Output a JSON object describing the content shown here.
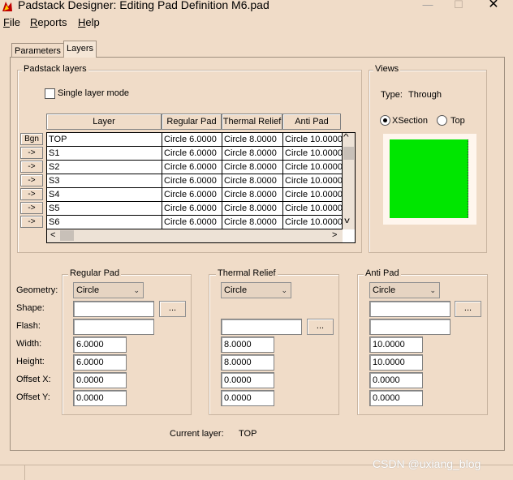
{
  "window": {
    "title": "Padstack Designer: Editing Pad Definition M6.pad",
    "app_icon": "app-logo-icon",
    "min_glyph": "—",
    "max_glyph": "☐",
    "close_glyph": "✕"
  },
  "menu": [
    {
      "label": "File",
      "key": "F",
      "rest": "ile"
    },
    {
      "label": "Reports",
      "key": "R",
      "rest": "eports"
    },
    {
      "label": "Help",
      "key": "H",
      "rest": "elp"
    }
  ],
  "tabs": [
    {
      "label": "Parameters",
      "selected": false
    },
    {
      "label": "Layers",
      "selected": true
    }
  ],
  "padstack_layers": {
    "group_title": "Padstack layers",
    "single_layer_mode_label": "Single layer mode",
    "single_layer_mode_checked": false,
    "columns": [
      "Layer",
      "Regular Pad",
      "Thermal Relief",
      "Anti Pad"
    ],
    "rows": [
      {
        "btn": "Bgn",
        "layer": "TOP",
        "regular": "Circle 6.0000",
        "thermal": "Circle 8.0000",
        "anti": "Circle 10.0000"
      },
      {
        "btn": "->",
        "layer": "S1",
        "regular": "Circle 6.0000",
        "thermal": "Circle 8.0000",
        "anti": "Circle 10.0000"
      },
      {
        "btn": "->",
        "layer": "S2",
        "regular": "Circle 6.0000",
        "thermal": "Circle 8.0000",
        "anti": "Circle 10.0000"
      },
      {
        "btn": "->",
        "layer": "S3",
        "regular": "Circle 6.0000",
        "thermal": "Circle 8.0000",
        "anti": "Circle 10.0000"
      },
      {
        "btn": "->",
        "layer": "S4",
        "regular": "Circle 6.0000",
        "thermal": "Circle 8.0000",
        "anti": "Circle 10.0000"
      },
      {
        "btn": "->",
        "layer": "S5",
        "regular": "Circle 6.0000",
        "thermal": "Circle 8.0000",
        "anti": "Circle 10.0000"
      },
      {
        "btn": "->",
        "layer": "S6",
        "regular": "Circle 6.0000",
        "thermal": "Circle 8.0000",
        "anti": "Circle 10.0000"
      }
    ],
    "scroll_left_glyph": "<",
    "scroll_right_glyph": ">",
    "scroll_up_glyph": "^",
    "scroll_down_glyph": "v"
  },
  "views": {
    "group_title": "Views",
    "type_label": "Type:",
    "type_value": "Through",
    "options": [
      {
        "label": "XSection",
        "selected": true
      },
      {
        "label": "Top",
        "selected": false
      }
    ],
    "preview_color": "#00e600"
  },
  "pad_editor": {
    "row_labels": [
      "Geometry:",
      "Shape:",
      "Flash:",
      "Width:",
      "Height:",
      "Offset X:",
      "Offset Y:"
    ],
    "ellipsis": "...",
    "regular_pad": {
      "title": "Regular Pad",
      "geometry": "Circle",
      "shape": "",
      "flash": "",
      "width": "6.0000",
      "height": "6.0000",
      "offset_x": "0.0000",
      "offset_y": "0.0000"
    },
    "thermal_relief": {
      "title": "Thermal Relief",
      "geometry": "Circle",
      "flash": "",
      "width": "8.0000",
      "height": "8.0000",
      "offset_x": "0.0000",
      "offset_y": "0.0000"
    },
    "anti_pad": {
      "title": "Anti Pad",
      "geometry": "Circle",
      "shape": "",
      "flash": "",
      "width": "10.0000",
      "height": "10.0000",
      "offset_x": "0.0000",
      "offset_y": "0.0000"
    },
    "dropdown_glyph": "⌄"
  },
  "current_layer": {
    "label": "Current layer:",
    "value": "TOP"
  },
  "watermark": "CSDN @uxiang_blog"
}
